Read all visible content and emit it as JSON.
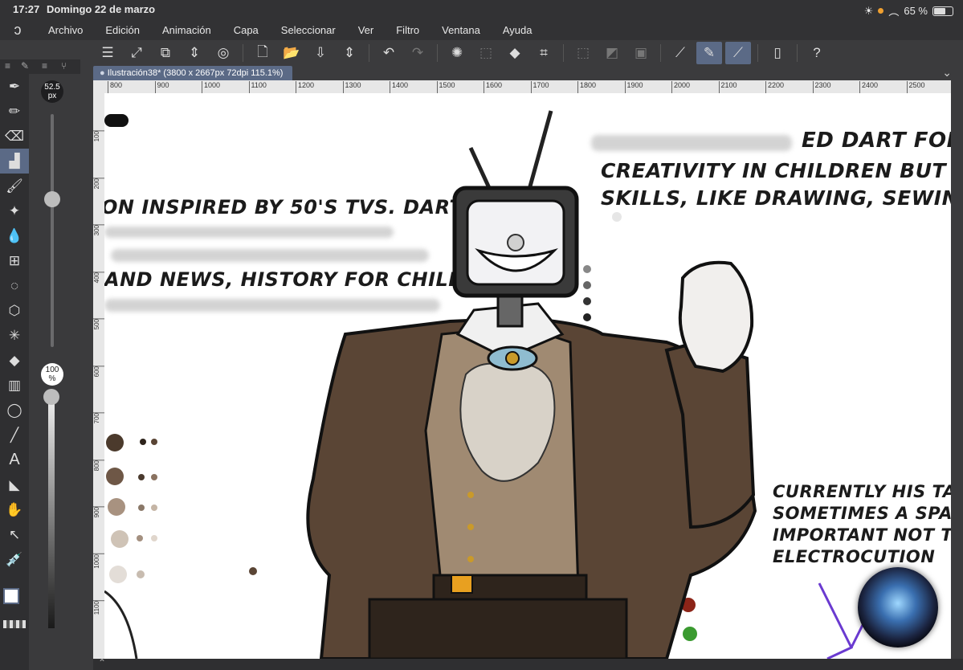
{
  "status": {
    "time": "17:27",
    "date": "Domingo 22 de marzo",
    "battery": "65 %"
  },
  "menu": {
    "items": [
      "Archivo",
      "Edición",
      "Animación",
      "Capa",
      "Seleccionar",
      "Ver",
      "Filtro",
      "Ventana",
      "Ayuda"
    ]
  },
  "toolbar": {
    "icons": [
      "menu-icon",
      "expand-canvas-icon",
      "transform-icon",
      "updown-icon",
      "spiral-icon",
      "new-doc-icon",
      "open-folder-icon",
      "save-icon",
      "updown2-icon",
      "undo-icon",
      "redo-icon",
      "loading-icon",
      "select-icon",
      "fill-icon",
      "crop-icon",
      "deselect-icon",
      "invert-icon",
      "frame-icon",
      "ruler-icon",
      "pen-stroke-icon",
      "pen-line-icon",
      "phone-icon",
      "help-icon"
    ]
  },
  "slider": {
    "size_value": "52.5",
    "size_unit": "px",
    "opacity_value": "100",
    "opacity_unit": "%"
  },
  "document": {
    "tab_label": "Ilustración38* (3800 x 2667px 72dpi 115.1%)"
  },
  "ruler": {
    "h": [
      "800",
      "900",
      "1000",
      "1100",
      "1200",
      "1300",
      "1400",
      "1500",
      "1600",
      "1700",
      "1800",
      "1900",
      "2000",
      "2100",
      "2200",
      "2300",
      "2400",
      "2500"
    ],
    "v": [
      "100",
      "200",
      "300",
      "400",
      "500",
      "600",
      "700",
      "800",
      "900",
      "1000",
      "1100"
    ]
  },
  "canvas": {
    "left_text": [
      "ON INSPIRED BY 50's TVs. DART",
      "AND NEWS, HISTORY FOR CHILDREN,"
    ],
    "right_text": [
      "ED DART FOR CRA",
      "CREATIVITY IN CHILDREN BUT ALSO",
      "SKILLS, LIKE DRAWING, SEWING AN"
    ],
    "bottom_text": [
      "CURRENTLY HIS TAIL I",
      "SOMETIMES A SPARK",
      "IMPORTANT NOT TO T",
      "ELECTROCUTION"
    ]
  },
  "colors": {
    "accent": "#5b6a86",
    "coat": "#5a4535",
    "vest": "#a08a72"
  }
}
